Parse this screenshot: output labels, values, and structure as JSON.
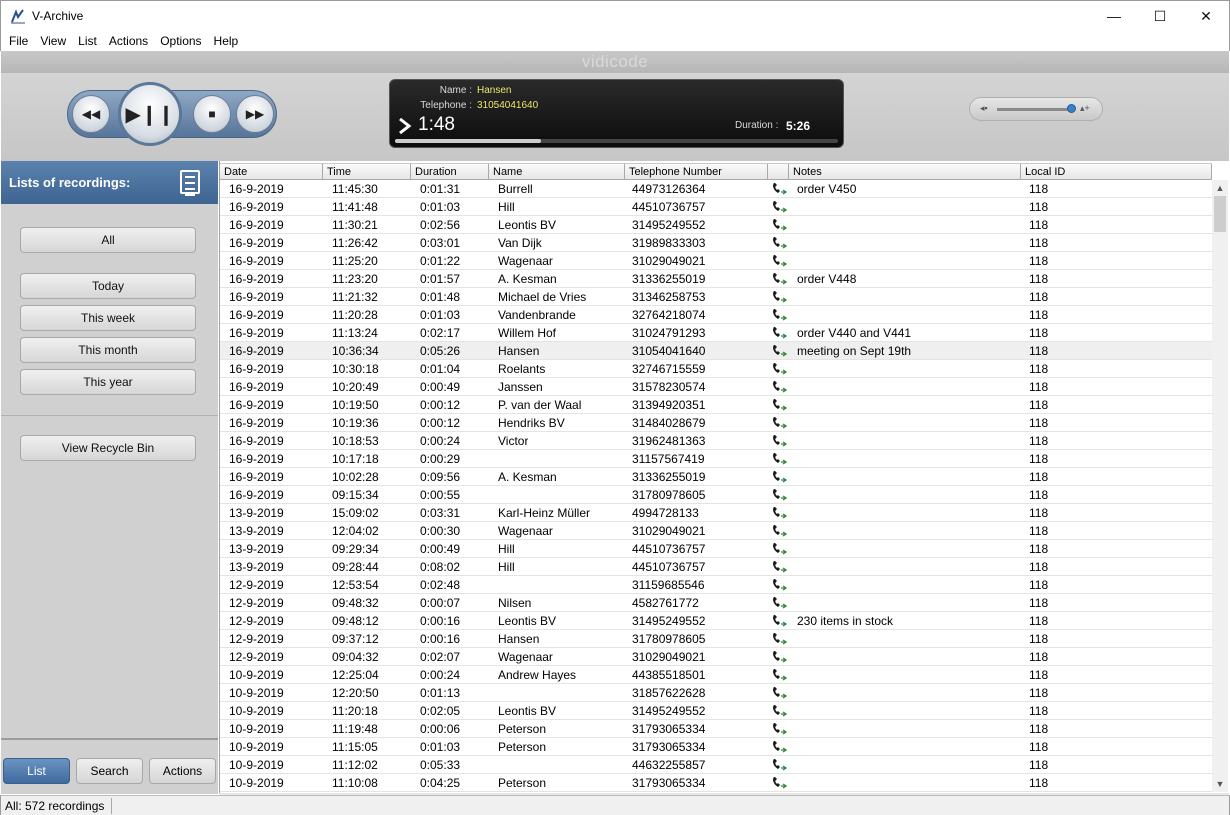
{
  "window": {
    "title": "V-Archive",
    "controls": {
      "minimize": "—",
      "maximize": "☐",
      "close": "✕"
    }
  },
  "menu": [
    "File",
    "View",
    "List",
    "Actions",
    "Options",
    "Help"
  ],
  "brand": "vidicode",
  "player": {
    "name_label": "Name :",
    "name_value": "Hansen",
    "telephone_label": "Telephone :",
    "telephone_value": "31054041640",
    "elapsed": "1:48",
    "duration_label": "Duration :",
    "duration_value": "5:26",
    "progress_fraction": 0.33,
    "volume_fraction": 0.95,
    "buttons": {
      "rewind": "◀◀",
      "play_pause": "▶❙❙",
      "stop": "■",
      "forward": "▶▶"
    },
    "accent_color": "#e8e86a"
  },
  "sidebar": {
    "header": "Lists of recordings:",
    "buttons": {
      "all": "All",
      "today": "Today",
      "this_week": "This week",
      "this_month": "This month",
      "this_year": "This year",
      "recycle": "View Recycle Bin"
    },
    "tabs": {
      "list": "List",
      "search": "Search",
      "actions": "Actions"
    },
    "header_color": "#4a719e"
  },
  "table": {
    "columns": [
      "Date",
      "Time",
      "Duration",
      "Name",
      "Telephone Number",
      "",
      "Notes",
      "Local ID"
    ],
    "rows": [
      [
        "16-9-2019",
        "11:45:30",
        "0:01:31",
        "Burrell",
        "44973126364",
        "order V450",
        "118"
      ],
      [
        "16-9-2019",
        "11:41:48",
        "0:01:03",
        "Hill",
        "44510736757",
        "",
        "118"
      ],
      [
        "16-9-2019",
        "11:30:21",
        "0:02:56",
        "Leontis BV",
        "31495249552",
        "",
        "118"
      ],
      [
        "16-9-2019",
        "11:26:42",
        "0:03:01",
        "Van Dijk",
        "31989833303",
        "",
        "118"
      ],
      [
        "16-9-2019",
        "11:25:20",
        "0:01:22",
        "Wagenaar",
        "31029049021",
        "",
        "118"
      ],
      [
        "16-9-2019",
        "11:23:20",
        "0:01:57",
        "A. Kesman",
        "31336255019",
        "order V448",
        "118"
      ],
      [
        "16-9-2019",
        "11:21:32",
        "0:01:48",
        "Michael de Vries",
        "31346258753",
        "",
        "118"
      ],
      [
        "16-9-2019",
        "11:20:28",
        "0:01:03",
        "Vandenbrande",
        "32764218074",
        "",
        "118"
      ],
      [
        "16-9-2019",
        "11:13:24",
        "0:02:17",
        "Willem Hof",
        "31024791293",
        "order V440 and V441",
        "118"
      ],
      [
        "16-9-2019",
        "10:36:34",
        "0:05:26",
        "Hansen",
        "31054041640",
        "meeting on Sept 19th",
        "118"
      ],
      [
        "16-9-2019",
        "10:30:18",
        "0:01:04",
        "Roelants",
        "32746715559",
        "",
        "118"
      ],
      [
        "16-9-2019",
        "10:20:49",
        "0:00:49",
        "Janssen",
        "31578230574",
        "",
        "118"
      ],
      [
        "16-9-2019",
        "10:19:50",
        "0:00:12",
        "P. van der Waal",
        "31394920351",
        "",
        "118"
      ],
      [
        "16-9-2019",
        "10:19:36",
        "0:00:12",
        "Hendriks BV",
        "31484028679",
        "",
        "118"
      ],
      [
        "16-9-2019",
        "10:18:53",
        "0:00:24",
        "Victor",
        "31962481363",
        "",
        "118"
      ],
      [
        "16-9-2019",
        "10:17:18",
        "0:00:29",
        "",
        "31157567419",
        "",
        "118"
      ],
      [
        "16-9-2019",
        "10:02:28",
        "0:09:56",
        "A. Kesman",
        "31336255019",
        "",
        "118"
      ],
      [
        "16-9-2019",
        "09:15:34",
        "0:00:55",
        "",
        "31780978605",
        "",
        "118"
      ],
      [
        "13-9-2019",
        "15:09:02",
        "0:03:31",
        "Karl-Heinz Müller",
        "4994728133",
        "",
        "118"
      ],
      [
        "13-9-2019",
        "12:04:02",
        "0:00:30",
        "Wagenaar",
        "31029049021",
        "",
        "118"
      ],
      [
        "13-9-2019",
        "09:29:34",
        "0:00:49",
        "Hill",
        "44510736757",
        "",
        "118"
      ],
      [
        "13-9-2019",
        "09:28:44",
        "0:08:02",
        "Hill",
        "44510736757",
        "",
        "118"
      ],
      [
        "12-9-2019",
        "12:53:54",
        "0:02:48",
        "",
        "31159685546",
        "",
        "118"
      ],
      [
        "12-9-2019",
        "09:48:32",
        "0:00:07",
        "Nilsen",
        "4582761772",
        "",
        "118"
      ],
      [
        "12-9-2019",
        "09:48:12",
        "0:00:16",
        "Leontis BV",
        "31495249552",
        "230 items in stock",
        "118"
      ],
      [
        "12-9-2019",
        "09:37:12",
        "0:00:16",
        "Hansen",
        "31780978605",
        "",
        "118"
      ],
      [
        "12-9-2019",
        "09:04:32",
        "0:02:07",
        "Wagenaar",
        "31029049021",
        "",
        "118"
      ],
      [
        "10-9-2019",
        "12:25:04",
        "0:00:24",
        "Andrew Hayes",
        "44385518501",
        "",
        "118"
      ],
      [
        "10-9-2019",
        "12:20:50",
        "0:01:13",
        "",
        "31857622628",
        "",
        "118"
      ],
      [
        "10-9-2019",
        "11:20:18",
        "0:02:05",
        "Leontis BV",
        "31495249552",
        "",
        "118"
      ],
      [
        "10-9-2019",
        "11:19:48",
        "0:00:06",
        "Peterson",
        "31793065334",
        "",
        "118"
      ],
      [
        "10-9-2019",
        "11:15:05",
        "0:01:03",
        "Peterson",
        "31793065334",
        "",
        "118"
      ],
      [
        "10-9-2019",
        "11:12:02",
        "0:05:33",
        "",
        "44632255857",
        "",
        "118"
      ],
      [
        "10-9-2019",
        "11:10:08",
        "0:04:25",
        "Peterson",
        "31793065334",
        "",
        "118"
      ]
    ],
    "selected_row": 9
  },
  "status": {
    "text": "All: 572 recordings"
  }
}
